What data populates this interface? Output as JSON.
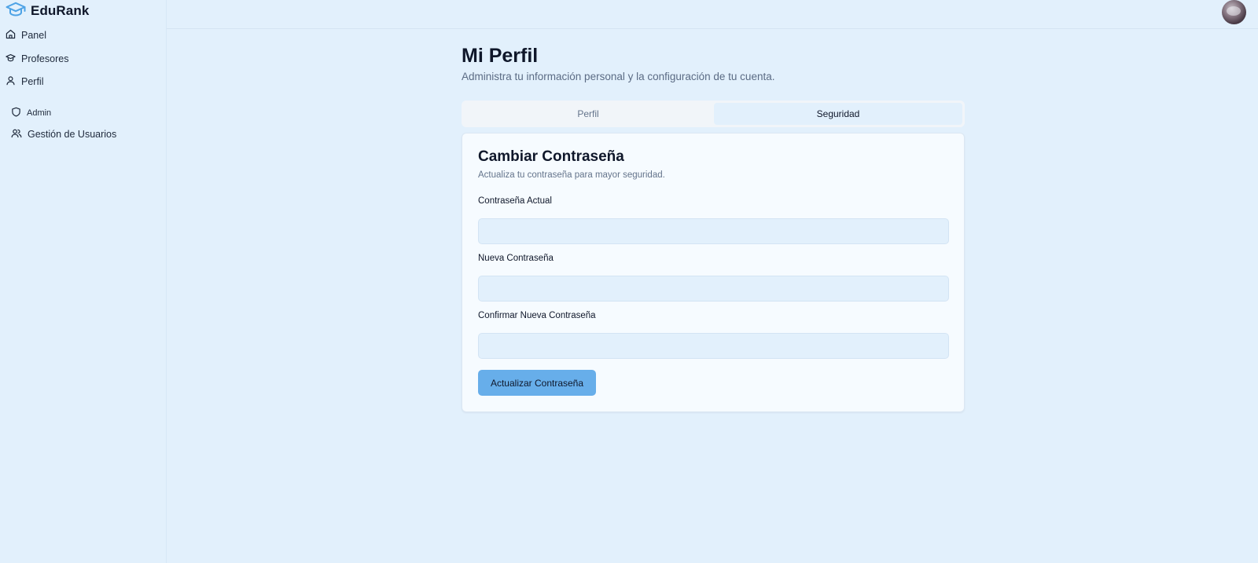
{
  "app": {
    "name": "EduRank",
    "logo_icon": "graduation-cap-icon",
    "accent_color": "#4ea3e6"
  },
  "sidebar": {
    "items": [
      {
        "label": "Panel",
        "icon": "home-icon"
      },
      {
        "label": "Profesores",
        "icon": "graduation-cap-icon"
      },
      {
        "label": "Perfil",
        "icon": "user-icon"
      }
    ],
    "admin": {
      "label": "Admin",
      "icon": "shield-icon",
      "items": [
        {
          "label": "Gestión de Usuarios",
          "icon": "users-icon"
        }
      ]
    }
  },
  "header": {
    "avatar": "user-avatar"
  },
  "main": {
    "title": "Mi Perfil",
    "subtitle": "Administra tu información personal y la configuración de tu cuenta.",
    "tabs": [
      {
        "label": "Perfil",
        "active": false
      },
      {
        "label": "Seguridad",
        "active": true
      }
    ],
    "card": {
      "title": "Cambiar Contraseña",
      "description": "Actualiza tu contraseña para mayor seguridad.",
      "fields": [
        {
          "label": "Contraseña Actual",
          "value": "",
          "placeholder": ""
        },
        {
          "label": "Nueva Contraseña",
          "value": "",
          "placeholder": ""
        },
        {
          "label": "Confirmar Nueva Contraseña",
          "value": "",
          "placeholder": ""
        }
      ],
      "submit_label": "Actualizar Contraseña",
      "button_color": "#67aeea"
    }
  }
}
